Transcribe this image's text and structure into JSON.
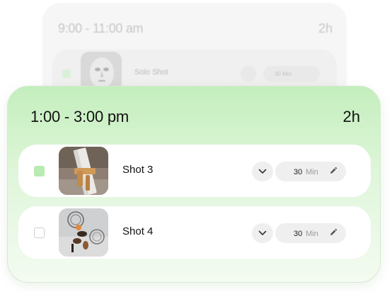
{
  "background_block": {
    "time_range": "9:00 - 11:00 am",
    "duration": "2h",
    "shot": {
      "title": "Solo Shot",
      "checked": true,
      "duration_value": "30",
      "duration_unit": "Min",
      "thumbnail": "stone-face-sculpture-thumbnail"
    }
  },
  "active_block": {
    "time_range": "1:00 - 3:00 pm",
    "duration": "2h",
    "accent_color": "#c4eebd",
    "shots": [
      {
        "title": "Shot 3",
        "checked": true,
        "duration_value": "30",
        "duration_unit": "Min",
        "thumbnail": "wood-and-rectangle-object-thumbnail"
      },
      {
        "title": "Shot 4",
        "checked": false,
        "duration_value": "30",
        "duration_unit": "Min",
        "thumbnail": "rings-and-beads-sculpture-thumbnail"
      }
    ]
  },
  "icons": {
    "expand": "chevron-down-icon",
    "edit": "pencil-icon"
  }
}
